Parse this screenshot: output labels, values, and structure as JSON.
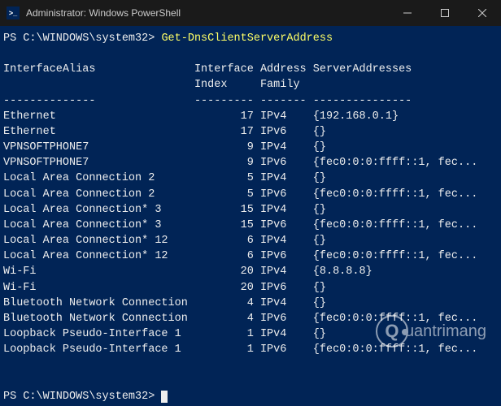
{
  "titlebar": {
    "title": "Administrator: Windows PowerShell",
    "icon_label": ">_"
  },
  "window_controls": {
    "minimize": "minimize",
    "maximize": "maximize",
    "close": "close"
  },
  "prompt1": {
    "path": "PS C:\\WINDOWS\\system32> ",
    "command": "Get-DnsClientServerAddress"
  },
  "table": {
    "headers": {
      "col1": "InterfaceAlias",
      "col2": "Interface",
      "col2b": "Index",
      "col3": "Address",
      "col3b": "Family",
      "col4": "ServerAddresses"
    },
    "rows": [
      {
        "alias": "Ethernet",
        "index": "17",
        "family": "IPv4",
        "servers": "{192.168.0.1}"
      },
      {
        "alias": "Ethernet",
        "index": "17",
        "family": "IPv6",
        "servers": "{}"
      },
      {
        "alias": "VPNSOFTPHONE7",
        "index": "9",
        "family": "IPv4",
        "servers": "{}"
      },
      {
        "alias": "VPNSOFTPHONE7",
        "index": "9",
        "family": "IPv6",
        "servers": "{fec0:0:0:ffff::1, fec..."
      },
      {
        "alias": "Local Area Connection 2",
        "index": "5",
        "family": "IPv4",
        "servers": "{}"
      },
      {
        "alias": "Local Area Connection 2",
        "index": "5",
        "family": "IPv6",
        "servers": "{fec0:0:0:ffff::1, fec..."
      },
      {
        "alias": "Local Area Connection* 3",
        "index": "15",
        "family": "IPv4",
        "servers": "{}"
      },
      {
        "alias": "Local Area Connection* 3",
        "index": "15",
        "family": "IPv6",
        "servers": "{fec0:0:0:ffff::1, fec..."
      },
      {
        "alias": "Local Area Connection* 12",
        "index": "6",
        "family": "IPv4",
        "servers": "{}"
      },
      {
        "alias": "Local Area Connection* 12",
        "index": "6",
        "family": "IPv6",
        "servers": "{fec0:0:0:ffff::1, fec..."
      },
      {
        "alias": "Wi-Fi",
        "index": "20",
        "family": "IPv4",
        "servers": "{8.8.8.8}"
      },
      {
        "alias": "Wi-Fi",
        "index": "20",
        "family": "IPv6",
        "servers": "{}"
      },
      {
        "alias": "Bluetooth Network Connection",
        "index": "4",
        "family": "IPv4",
        "servers": "{}"
      },
      {
        "alias": "Bluetooth Network Connection",
        "index": "4",
        "family": "IPv6",
        "servers": "{fec0:0:0:ffff::1, fec..."
      },
      {
        "alias": "Loopback Pseudo-Interface 1",
        "index": "1",
        "family": "IPv4",
        "servers": "{}"
      },
      {
        "alias": "Loopback Pseudo-Interface 1",
        "index": "1",
        "family": "IPv6",
        "servers": "{fec0:0:0:ffff::1, fec..."
      }
    ]
  },
  "prompt2": {
    "path": "PS C:\\WINDOWS\\system32> "
  },
  "watermark": {
    "glyph": "Q",
    "text": "uantrimang"
  }
}
